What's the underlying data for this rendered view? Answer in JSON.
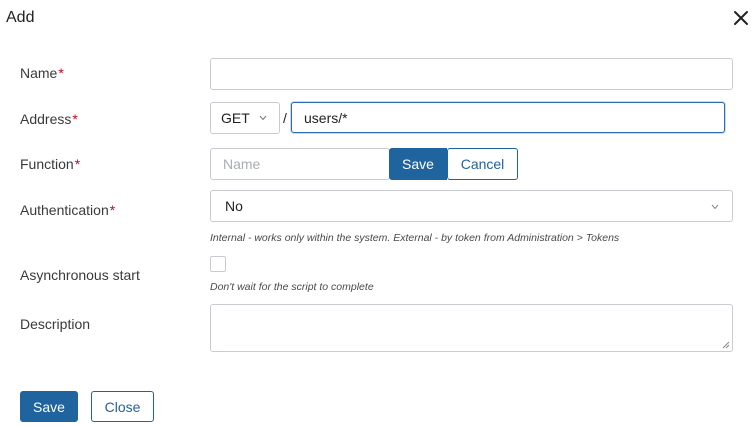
{
  "dialog": {
    "title": "Add"
  },
  "colors": {
    "accent": "#1f639f",
    "required": "#d0021b",
    "border": "#c8ccd0",
    "focus": "#2b6bb5"
  },
  "icons": {
    "close": "close-icon",
    "chevron": "chevron-down-icon",
    "resize": "resize-handle-icon"
  },
  "form": {
    "name": {
      "label": "Name",
      "required_mark": "*",
      "value": ""
    },
    "address": {
      "label": "Address",
      "required_mark": "*",
      "method": "GET",
      "separator": "/",
      "value": "users/*"
    },
    "function": {
      "label": "Function",
      "required_mark": "*",
      "placeholder": "Name",
      "save_label": "Save",
      "cancel_label": "Cancel"
    },
    "authentication": {
      "label": "Authentication",
      "required_mark": "*",
      "selected": "No",
      "hint": "Internal - works only within the system. External - by token from Administration > Tokens"
    },
    "async_start": {
      "label": "Asynchronous start",
      "checked": false,
      "hint": "Don't wait for the script to complete"
    },
    "description": {
      "label": "Description",
      "value": ""
    }
  },
  "footer": {
    "save_label": "Save",
    "close_label": "Close"
  }
}
